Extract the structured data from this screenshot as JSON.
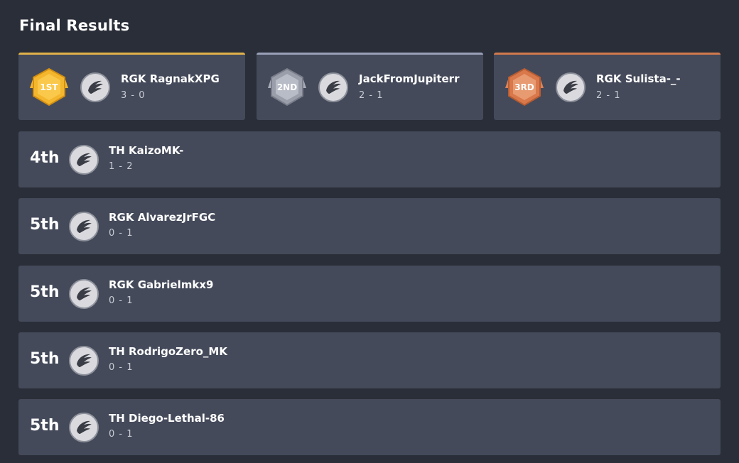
{
  "title": "Final Results",
  "podium": [
    {
      "medal": "1ST",
      "name": "RGK RagnakXPG",
      "score": "3 - 0",
      "accent": "#e0b24a"
    },
    {
      "medal": "2ND",
      "name": "JackFromJupiterr",
      "score": "2 - 1",
      "accent": "#9aa0b8"
    },
    {
      "medal": "3RD",
      "name": "RGK Sulista-_-",
      "score": "2 - 1",
      "accent": "#d27a4e"
    }
  ],
  "rows": [
    {
      "place": "4th",
      "name": "TH KaizoMK-",
      "score": "1 - 2"
    },
    {
      "place": "5th",
      "name": "RGK AlvarezJrFGC",
      "score": "0 - 1"
    },
    {
      "place": "5th",
      "name": "RGK Gabrielmkx9",
      "score": "0 - 1"
    },
    {
      "place": "5th",
      "name": "TH RodrigoZero_MK",
      "score": "0 - 1"
    },
    {
      "place": "5th",
      "name": "TH Diego-Lethal-86",
      "score": "0 - 1"
    }
  ],
  "icons": {
    "avatar": "wing-logo-icon",
    "medal": "medal-badge-icon"
  }
}
